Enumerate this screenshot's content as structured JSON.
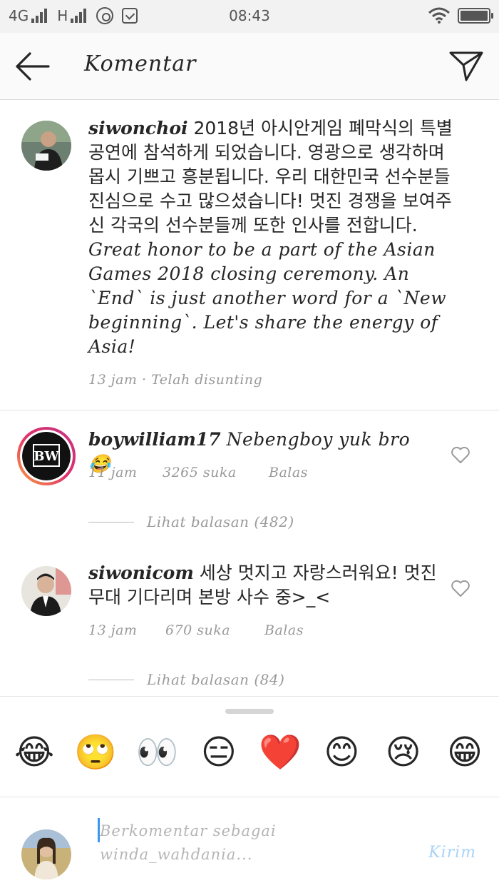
{
  "status_bar": {
    "network_1": "4G",
    "network_2": "H",
    "time": "08:43",
    "battery_level": 1.0
  },
  "header": {
    "title": "Komentar",
    "back_icon": "arrow-left-icon",
    "send_icon": "paper-plane-icon"
  },
  "caption": {
    "username": "siwonchoi",
    "text_korean": "2018년 아시안게임 폐막식의 특별공연에 참석하게 되었습니다. 영광으로 생각하며 몹시 기쁘고 흥분됩니다. 우리 대한민국 선수분들 진심으로 수고 많으셨습니다! 멋진 경쟁을 보여주신 각국의 선수분들께 또한 인사를 전합니다.",
    "text_english": "Great honor to be a part of the Asian Games 2018 closing ceremony. An `End` is just another word for a `New beginning`. Let's share the energy of Asia!",
    "time": "13 jam",
    "separator": "·",
    "edited": "Telah disunting"
  },
  "comments": [
    {
      "username": "boywilliam17",
      "text": "Nebengboy yuk bro 😂",
      "time": "11 jam",
      "likes": "3265 suka",
      "reply_label": "Balas",
      "view_replies": "Lihat balasan (482)"
    },
    {
      "username": "siwonicom",
      "text": "세상 멋지고 자랑스러워요! 멋진 무대 기다리며 본방 사수 중>_<",
      "time": "13 jam",
      "likes": "670 suka",
      "reply_label": "Balas",
      "view_replies": "Lihat balasan (84)"
    }
  ],
  "emoji_bar": {
    "emojis": [
      "😂",
      "🙄",
      "👀",
      "😑",
      "❤️",
      "😊",
      "😢",
      "😁"
    ]
  },
  "comment_input": {
    "placeholder": "Berkomentar sebagai winda_wahdania...",
    "post_label": "Kirim"
  },
  "colors": {
    "accent": "#3897f0",
    "post_disabled": "#a8d3f7",
    "muted_text": "#999999"
  }
}
